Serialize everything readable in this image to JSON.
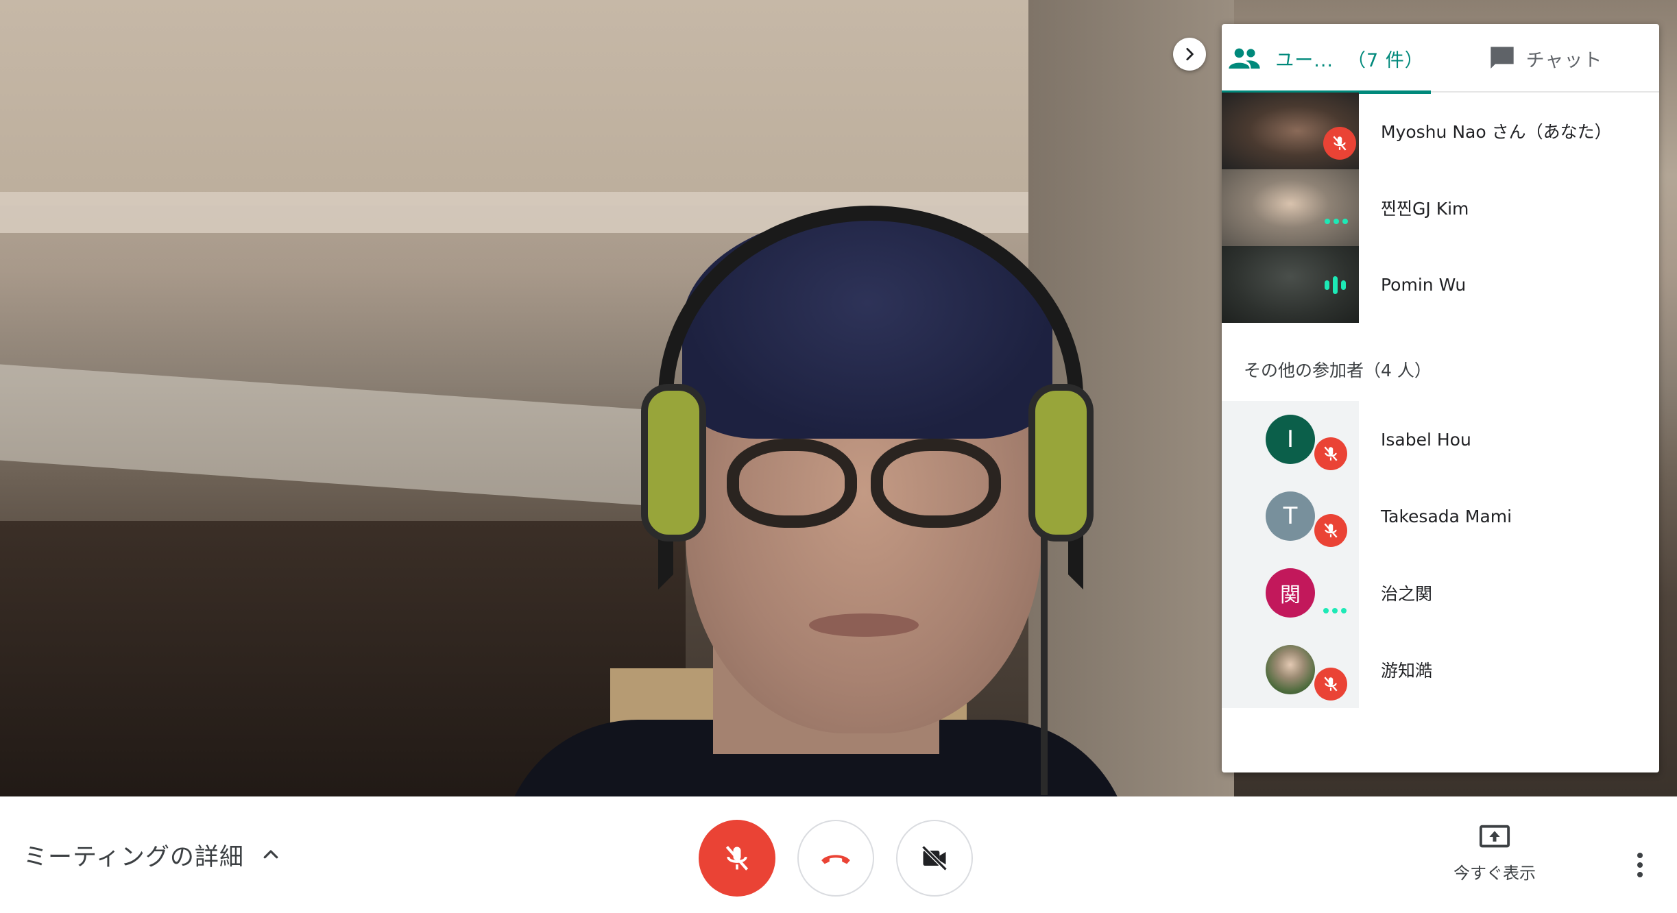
{
  "tabs": {
    "people_label": "ユー...",
    "people_count": "（7 件）",
    "chat_label": "チャット"
  },
  "participants_in_view": [
    {
      "name": "Myoshu Nao さん（あなた）",
      "status": "muted"
    },
    {
      "name": "찐찐GJ Kim",
      "status": "connecting"
    },
    {
      "name": "Pomin Wu",
      "status": "speaking"
    }
  ],
  "others_title": "その他の参加者（4 人）",
  "other_participants": [
    {
      "name": "Isabel Hou",
      "initial": "I",
      "avatar_color": "#0b5f4a",
      "status": "muted"
    },
    {
      "name": "Takesada Mami",
      "initial": "T",
      "avatar_color": "#78909c",
      "status": "muted"
    },
    {
      "name": "治之関",
      "initial": "関",
      "avatar_color": "#c2185b",
      "status": "connecting"
    },
    {
      "name": "游知澔",
      "initial": "",
      "avatar_color": "#5b7a4a",
      "status": "muted"
    }
  ],
  "bottom_bar": {
    "meeting_details_label": "ミーティングの詳細",
    "present_label": "今すぐ表示"
  },
  "colors": {
    "accent": "#00897b",
    "mute_red": "#ea4335",
    "activity": "#1de9b6"
  },
  "icons": {
    "people_tab": "people-icon",
    "chat_tab": "chat-icon",
    "collapse": "chevron-right-icon",
    "mic": "mic-off-icon",
    "hangup": "phone-hangup-icon",
    "camera": "videocam-off-icon",
    "present": "present-screen-icon",
    "more": "more-vert-icon"
  }
}
